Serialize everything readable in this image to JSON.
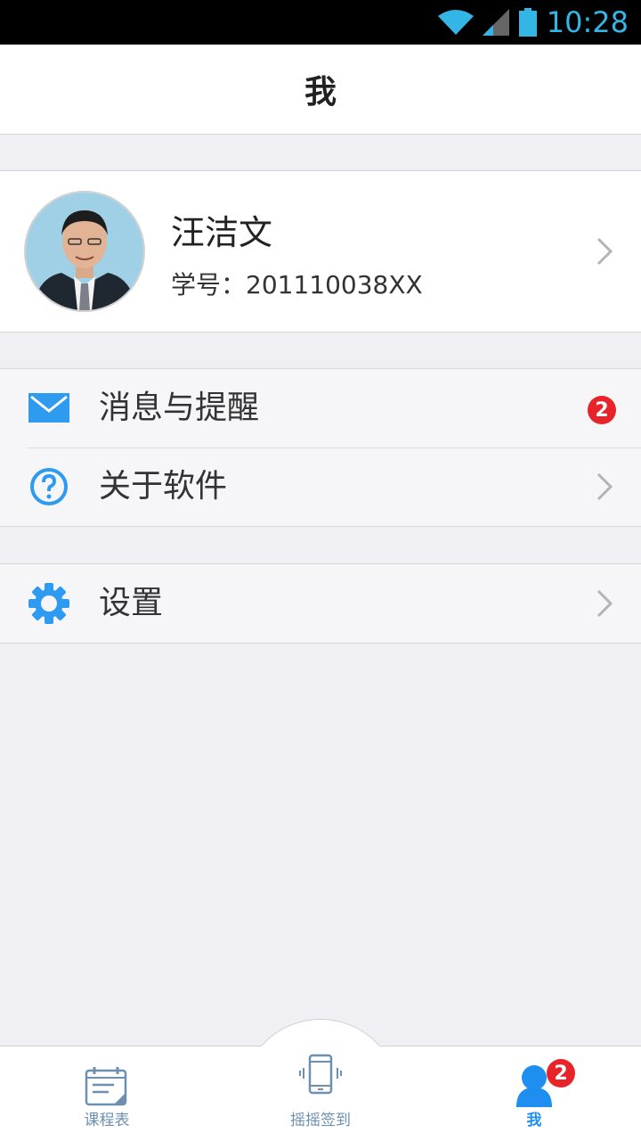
{
  "status_bar": {
    "time": "10:28",
    "wifi_icon": "wifi-icon",
    "signal_icon": "signal-icon",
    "battery_icon": "battery-icon",
    "accent_color": "#33b5e5"
  },
  "header": {
    "title": "我"
  },
  "profile": {
    "name": "汪洁文",
    "student_id": "学号：201110038XX",
    "avatar_icon": "avatar"
  },
  "menu": {
    "messages": {
      "label": "消息与提醒",
      "icon": "mail-icon",
      "badge": "2"
    },
    "about": {
      "label": "关于软件",
      "icon": "help-icon"
    },
    "settings": {
      "label": "设置",
      "icon": "gear-icon"
    }
  },
  "tabbar": {
    "schedule": {
      "label": "课程表",
      "icon": "calendar-icon"
    },
    "shake": {
      "label": "摇摇签到",
      "icon": "phone-shake-icon"
    },
    "me": {
      "label": "我",
      "icon": "user-icon",
      "badge": "2",
      "active_color": "#1e8ef0"
    }
  },
  "colors": {
    "accent": "#2e9bf0",
    "badge": "#e8242b",
    "background": "#efeff4"
  }
}
